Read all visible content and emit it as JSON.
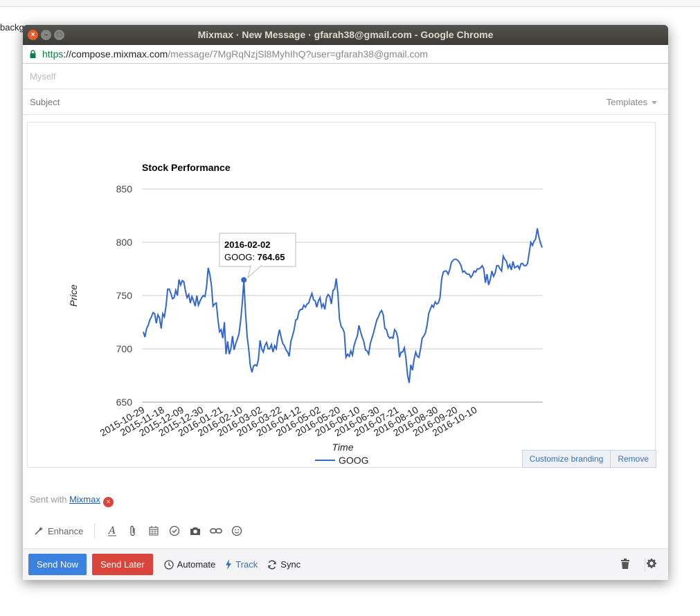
{
  "background": {
    "text": "backg"
  },
  "window": {
    "title": "Mixmax · New Message · gfarah38@gmail.com - Google Chrome",
    "controls": {
      "close": "×",
      "minimize": "–",
      "maximize": "□"
    }
  },
  "address_bar": {
    "scheme": "https",
    "host": "://compose.mixmax.com",
    "path": "/message/7MgRqNzjSl8MyhIhQ?user=gfarah38@gmail.com"
  },
  "compose": {
    "to_placeholder": "Myself",
    "subject_label": "Subject",
    "templates_label": "Templates"
  },
  "chart_data": {
    "type": "line",
    "title": "Stock Performance",
    "xlabel": "Time",
    "ylabel": "Price",
    "ylim": [
      650,
      850
    ],
    "yticks": [
      "850",
      "800",
      "750",
      "700",
      "650"
    ],
    "x_ticks": [
      "2015-10-29",
      "2015-11-18",
      "2015-12-09",
      "2015-12-30",
      "2016-01-21",
      "2016-02-10",
      "2016-03-02",
      "2016-03-22",
      "2016-04-12",
      "2016-05-02",
      "2016-05-20",
      "2016-06-10",
      "2016-06-30",
      "2016-07-21",
      "2016-08-10",
      "2016-08-30",
      "2016-09-20",
      "2016-10-10"
    ],
    "legend": "bottom",
    "grid": true,
    "series": [
      {
        "name": "GOOG",
        "color": "#3366cc",
        "values": [
          716,
          711,
          719,
          722,
          727,
          730,
          734,
          733,
          724,
          732,
          729,
          719,
          733,
          730,
          740,
          756,
          756,
          752,
          747,
          748,
          755,
          750,
          765,
          760,
          764,
          763,
          754,
          748,
          751,
          743,
          749,
          745,
          740,
          750,
          741,
          745,
          748,
          750,
          749,
          758,
          776,
          770,
          760,
          740,
          742,
          743,
          728,
          716,
          718,
          710,
          725,
          695,
          707,
          695,
          700,
          712,
          699,
          705,
          709,
          714,
          726,
          742,
          764,
          735,
          712,
          700,
          684,
          678,
          684,
          685,
          684,
          690,
          708,
          700,
          697,
          703,
          706,
          700,
          700,
          704,
          697,
          703,
          700,
          711,
          718,
          711,
          705,
          703,
          699,
          697,
          693,
          707,
          712,
          718,
          727,
          728,
          735,
          737,
          737,
          741,
          739,
          742,
          743,
          748,
          752,
          746,
          745,
          739,
          745,
          748,
          739,
          742,
          737,
          748,
          751,
          749,
          742,
          755,
          756,
          766,
          752,
          728,
          721,
          719,
          715,
          692,
          695,
          693,
          698,
          694,
          703,
          708,
          712,
          722,
          716,
          711,
          707,
          699,
          698,
          695,
          705,
          710,
          715,
          721,
          727,
          730,
          734,
          736,
          732,
          719,
          718,
          712,
          710,
          711,
          710,
          718,
          716,
          710,
          692,
          697,
          697,
          701,
          691,
          675,
          668,
          685,
          680,
          690,
          697,
          693,
          692,
          700,
          710,
          712,
          715,
          722,
          733,
          737,
          741,
          739,
          744,
          742,
          743,
          748,
          765,
          772,
          773,
          773,
          770,
          774,
          781,
          783,
          784,
          784,
          783,
          781,
          778,
          772,
          773,
          771,
          770,
          770,
          767,
          769,
          773,
          772,
          775,
          775,
          776,
          778,
          775,
          762,
          770,
          760,
          765,
          773,
          768,
          771,
          778,
          778,
          775,
          773,
          787,
          784,
          782,
          776,
          779,
          774,
          782,
          776,
          777,
          778,
          775,
          780,
          780,
          778,
          778,
          780,
          790,
          800,
          797,
          801,
          803,
          813,
          805,
          799,
          795
        ]
      }
    ],
    "tooltip": {
      "date": "2016-02-02",
      "series": "GOOG",
      "label": "GOOG: ",
      "value": "764.65"
    }
  },
  "card_actions": {
    "customize": "Customize branding",
    "remove": "Remove"
  },
  "signature": {
    "prefix": "Sent with ",
    "link": "Mixmax",
    "remove": "×"
  },
  "toolbar": {
    "enhance": "Enhance"
  },
  "footer": {
    "send_now": "Send Now",
    "send_later": "Send Later",
    "automate": "Automate",
    "track": "Track",
    "sync": "Sync"
  }
}
